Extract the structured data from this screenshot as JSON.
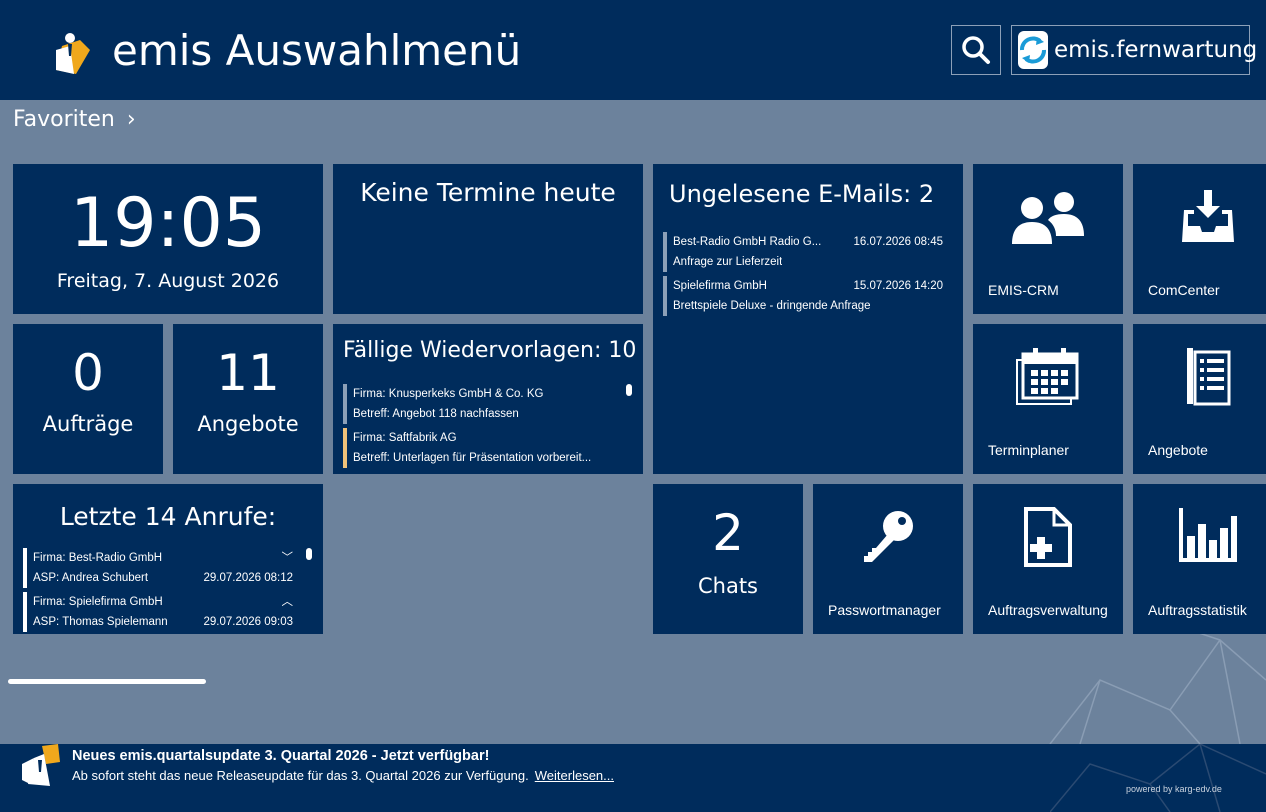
{
  "header": {
    "title": "emis Auswahlmenü",
    "search_icon": "search-icon",
    "remote_label": "emis.fernwartung"
  },
  "favorites": {
    "label": "Favoriten",
    "chevron": "›"
  },
  "clock": {
    "time": "19:05",
    "date": "Freitag, 7. August 2026"
  },
  "appointments": {
    "title": "Keine Termine heute"
  },
  "emails": {
    "title": "Ungelesene E-Mails: 2",
    "items": [
      {
        "sender": "Best-Radio GmbH Radio G...",
        "datetime": "16.07.2026 08:45",
        "subject": "Anfrage zur Lieferzeit"
      },
      {
        "sender": "Spielefirma GmbH",
        "datetime": "15.07.2026 14:20",
        "subject": "Brettspiele Deluxe - dringende Anfrage"
      }
    ]
  },
  "orders": {
    "count": "0",
    "label": "Aufträge"
  },
  "offers": {
    "count": "11",
    "label": "Angebote"
  },
  "followups": {
    "title": "Fällige Wiedervorlagen: 10",
    "items": [
      {
        "company": "Firma: Knusperkeks GmbH & Co. KG",
        "subject": "Betreff: Angebot 118 nachfassen"
      },
      {
        "company": "Firma: Saftfabrik AG",
        "subject": "Betreff: Unterlagen für Präsentation vorbereit..."
      }
    ]
  },
  "calls": {
    "title": "Letzte 14 Anrufe:",
    "items": [
      {
        "company": "Firma: Best-Radio GmbH",
        "contact": "ASP: Andrea Schubert",
        "datetime": "29.07.2026 08:12",
        "toggle": "﹀"
      },
      {
        "company": "Firma: Spielefirma GmbH",
        "contact": "ASP: Thomas Spielemann",
        "datetime": "29.07.2026 09:03",
        "toggle": "︿"
      }
    ]
  },
  "chats": {
    "count": "2",
    "label": "Chats"
  },
  "apps": {
    "crm": "EMIS-CRM",
    "comcenter": "ComCenter",
    "terminplaner": "Terminplaner",
    "angebote": "Angebote",
    "passwort": "Passwortmanager",
    "auftragsverwaltung": "Auftragsverwaltung",
    "auftragsstatistik": "Auftragsstatistik"
  },
  "footer": {
    "news_title": "Neues emis.quartalsupdate 3. Quartal 2026 - Jetzt verfügbar!",
    "news_body": "Ab sofort steht das neue Releaseupdate für das 3. Quartal 2026 zur Verfügung.",
    "news_link": "Weiterlesen...",
    "powered": "powered by karg-edv.de"
  },
  "colors": {
    "navy": "#002c5c",
    "background": "#6c829c",
    "accent_orange": "#f0a81c"
  }
}
